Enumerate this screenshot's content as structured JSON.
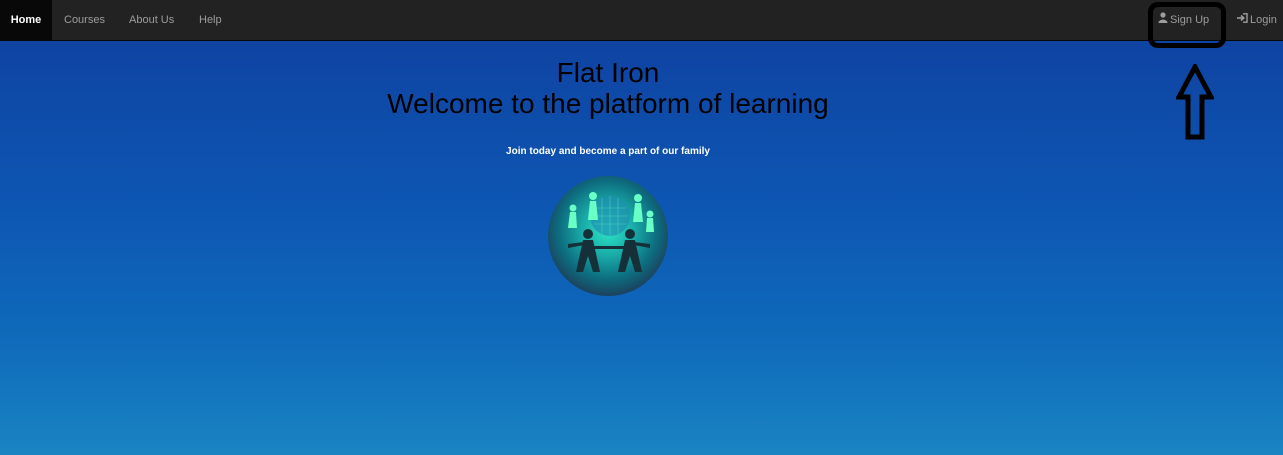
{
  "nav": {
    "home": "Home",
    "courses": "Courses",
    "about": "About Us",
    "help": "Help",
    "signup": "Sign Up",
    "login": "Login"
  },
  "main": {
    "title_line1": "Flat Iron",
    "title_line2": "Welcome to the platform of learning",
    "tagline": "Join today and become a part of our family"
  },
  "icons": {
    "signup": "user-icon",
    "login": "login-icon",
    "logo": "people-globe-logo"
  },
  "colors": {
    "navbar": "#222222",
    "background_top": "#103f9f",
    "background_bottom": "#1a84c2"
  }
}
